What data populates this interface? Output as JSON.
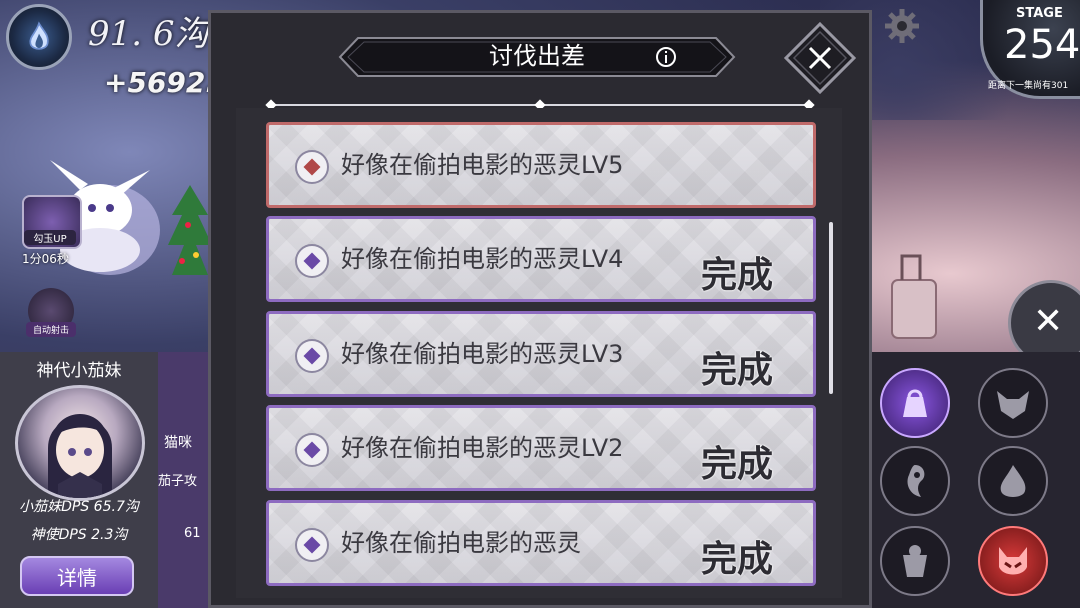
{
  "hud": {
    "currency": "91. 6沟",
    "income": "+5692."
  },
  "stage": {
    "label": "STAGE",
    "number": "254",
    "subtitle": "距离下一集尚有301"
  },
  "left": {
    "basket_label": "勾玉UP",
    "timer": "1分06秒",
    "autofire_label": "自动射击",
    "hero_name": "神代小茄妹",
    "hero_dps": "小茄妹DPS 65.7沟",
    "god_dps": "神使DPS 2.3沟",
    "detail_button": "详情",
    "mid_text1": "猫咪",
    "mid_text2": "茄子攻",
    "mid_text3": "61"
  },
  "modal": {
    "title": "讨伐出差",
    "items": [
      {
        "label": "好像在偷拍电影的恶灵LV5",
        "status": "",
        "variant": "red"
      },
      {
        "label": "好像在偷拍电影的恶灵LV4",
        "status": "完成",
        "variant": "purple"
      },
      {
        "label": "好像在偷拍电影的恶灵LV3",
        "status": "完成",
        "variant": "purple"
      },
      {
        "label": "好像在偷拍电影的恶灵LV2",
        "status": "完成",
        "variant": "purple"
      },
      {
        "label": "好像在偷拍电影的恶灵",
        "status": "完成",
        "variant": "purple"
      }
    ]
  },
  "icons": {
    "flame": "flame-orb-icon",
    "gear": "gear-icon",
    "info": "info-icon",
    "close": "close-icon",
    "categories": [
      "bag-icon",
      "fox-icon",
      "spirit-icon",
      "drop-icon",
      "ghost-icon",
      "demon-icon"
    ]
  },
  "colors": {
    "accent_purple": "#8d6bc0",
    "accent_red": "#c06a6a",
    "card_bg": "#dcdbe1"
  }
}
